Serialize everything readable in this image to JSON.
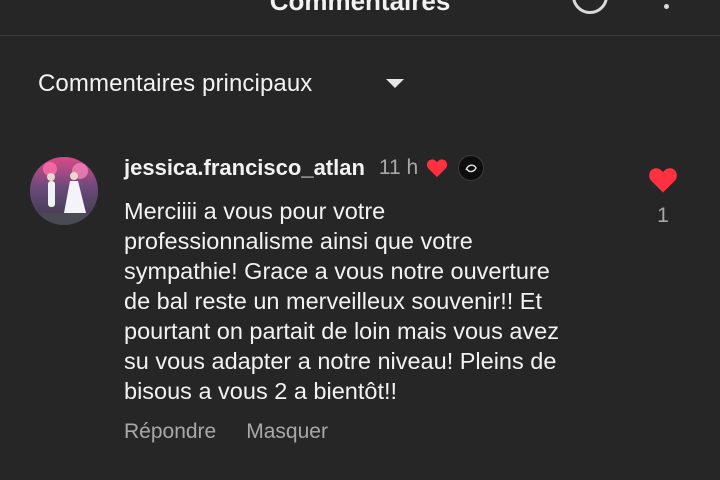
{
  "header": {
    "title": "Commentaires",
    "info_icon": "info-circle-icon",
    "more_icon": "more-vertical-icon"
  },
  "sort": {
    "label": "Commentaires principaux",
    "icon": "caret-down-icon"
  },
  "comment": {
    "username": "jessica.francisco_atlan",
    "time": "11 h",
    "creator_liked_icon": "heart-icon",
    "text": "Merciiii a vous pour votre\nprofessionnalisme ainsi que votre\nsympathie! Grace a vous notre ouverture\nde bal reste un merveilleux souvenir!! Et\npourtant on partait de loin mais vous avez\nsu vous adapter a notre niveau! Pleins de\nbisous a vous 2 a bientôt!!",
    "reply_label": "Répondre",
    "hide_label": "Masquer",
    "like_count": "1"
  },
  "colors": {
    "background": "#262626",
    "heart": "#ff3040",
    "muted_text": "#a8a8a8"
  }
}
